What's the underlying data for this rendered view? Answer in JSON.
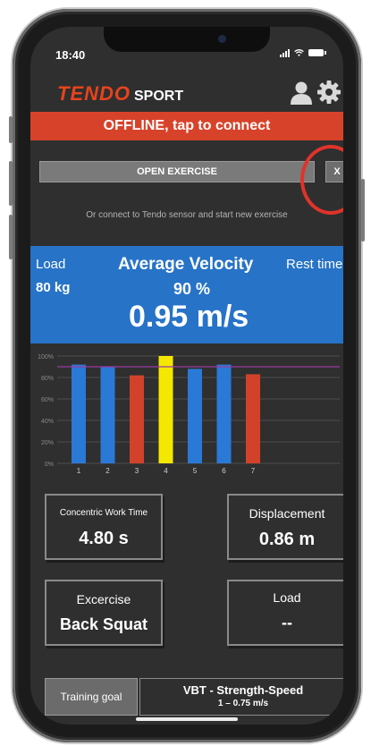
{
  "status_bar": {
    "time": "18:40"
  },
  "header": {
    "logo_main": "TENDO",
    "logo_sub": "SPORT"
  },
  "banner": {
    "offline_text": "OFFLINE, tap to connect"
  },
  "exercise_bar": {
    "open_label": "OPEN EXERCISE",
    "close_label": "X",
    "hint": "Or connect to Tendo sensor and start new exercise"
  },
  "velocity_panel": {
    "load_label": "Load",
    "load_value": "80 kg",
    "title": "Average Velocity",
    "rest_label": "Rest time",
    "percent": "90 %",
    "value": "0.95 m/s"
  },
  "chart_data": {
    "type": "bar",
    "categories": [
      "1",
      "2",
      "3",
      "4",
      "5",
      "6",
      "7"
    ],
    "values": [
      92,
      90,
      82,
      100,
      88,
      92,
      83
    ],
    "bar_colors": [
      "#2b79d6",
      "#2b79d6",
      "#d2422a",
      "#f5e800",
      "#2b79d6",
      "#2b79d6",
      "#d2422a"
    ],
    "y_ticks": [
      "0%",
      "20%",
      "40%",
      "60%",
      "80%",
      "100%"
    ],
    "ylim": [
      0,
      100
    ],
    "reference_line": 90,
    "reference_color": "#9a3aa0",
    "grid": true
  },
  "cards": {
    "concentric_label": "Concentric Work Time",
    "concentric_value": "4.80 s",
    "displacement_label": "Displacement",
    "displacement_value": "0.86 m",
    "exercise_label": "Excercise",
    "exercise_value": "Back Squat",
    "load_label": "Load",
    "load_value": "--"
  },
  "training_goal": {
    "label": "Training goal",
    "mode": "VBT - Strength-Speed",
    "range": "1 – 0.75 m/s"
  },
  "colors": {
    "accent_orange": "#e8431c",
    "banner_red": "#d7432a",
    "panel_blue": "#2773c7",
    "background": "#2f2f2f",
    "annotation_red": "#e0332b"
  },
  "icons": [
    "user-icon",
    "gear-icon",
    "signal-icon",
    "wifi-icon",
    "battery-icon"
  ]
}
